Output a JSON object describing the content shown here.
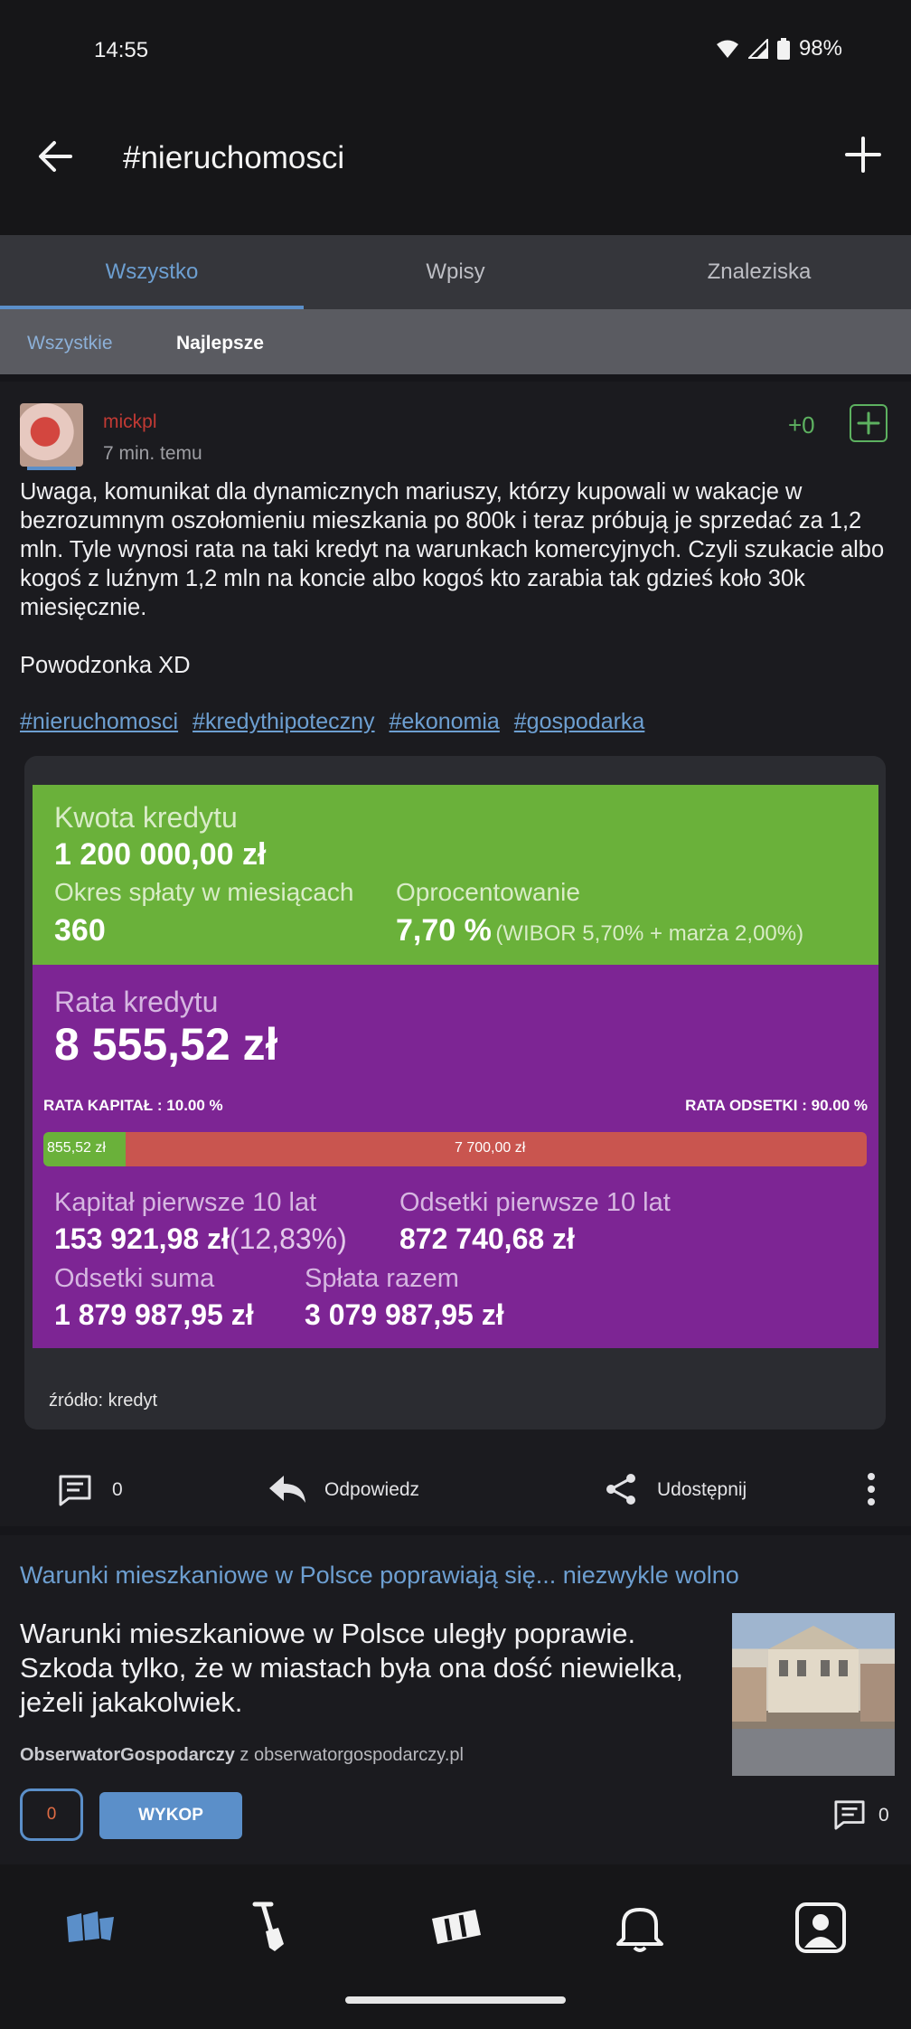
{
  "status_bar": {
    "time": "14:55",
    "battery": "98%"
  },
  "header": {
    "title": "#nieruchomosci"
  },
  "tabs": [
    {
      "label": "Wszystko",
      "active": true
    },
    {
      "label": "Wpisy",
      "active": false
    },
    {
      "label": "Znaleziska",
      "active": false
    }
  ],
  "subtabs": {
    "all": "Wszystkie",
    "best": "Najlepsze",
    "selected": "Najlepsze"
  },
  "post": {
    "author": "mickpl",
    "time": "7 min. temu",
    "votes": "+0",
    "paragraphs": [
      "Uwaga, komunikat dla dynamicznych mariuszy, którzy kupowali w wakacje w bezrozumnym oszołomieniu mieszkania po 800k i teraz próbują je sprzedać za 1,2 mln. Tyle wynosi rata na taki kredyt na warunkach komercyjnych. Czyli szukacie albo kogoś z luźnym 1,2 mln na koncie albo kogoś kto zarabia tak gdzieś koło 30k miesięcznie.",
      "Powodzonka XD"
    ],
    "tags": [
      "#nieruchomosci",
      "#kredythipoteczny",
      "#ekonomia",
      "#gospodarka"
    ],
    "embed": {
      "calculator": {
        "amount_label": "Kwota kredytu",
        "amount_value": "1 200 000,00 zł",
        "period_label": "Okres spłaty w miesiącach",
        "period_value": "360",
        "rate_label": "Oprocentowanie",
        "rate_value": "7,70 %",
        "rate_detail": "(WIBOR 5,70% + marża 2,00%)",
        "installment_label": "Rata kredytu",
        "installment_value": "8 555,52 zł",
        "capital_share_label": "RATA KAPITAŁ : 10.00 %",
        "interest_share_label": "RATA ODSETKI : 90.00 %",
        "capital_part": "855,52 zł",
        "interest_part": "7 700,00 zł",
        "capital_fraction": 0.1,
        "capital10_label": "Kapitał pierwsze 10 lat",
        "capital10_value": "153 921,98 zł",
        "capital10_pct": "(12,83%)",
        "interest10_label": "Odsetki pierwsze 10 lat",
        "interest10_value": "872 740,68 zł",
        "interest_total_label": "Odsetki suma",
        "interest_total_value": "1 879 987,95 zł",
        "total_label": "Spłata razem",
        "total_value": "3 079 987,95 zł",
        "colors": {
          "top": "#6ab13a",
          "bottom": "#7d2594",
          "bar_interest": "#c9554f"
        }
      },
      "source": "źródło: kredyt"
    },
    "actions": {
      "comments": "0",
      "reply": "Odpowiedz",
      "share": "Udostępnij"
    }
  },
  "link": {
    "title": "Warunki mieszkaniowe w Polsce poprawiają się... niezwykle wolno",
    "body": "Warunki mieszkaniowe w Polsce uległy poprawie. Szkoda tylko, że w miastach była ona dość niewielka, jeżeli jakakolwiek.",
    "author": "ObserwatorGospodarczy",
    "from": "z obserwatorgospodarczy.pl",
    "votes": "0",
    "button": "WYKOP",
    "comments": "0"
  },
  "bottom_nav": [
    "wykop-home-icon",
    "shovel-icon",
    "microblog-icon",
    "bell-icon",
    "profile-icon"
  ],
  "accent": "#5b8fc9"
}
